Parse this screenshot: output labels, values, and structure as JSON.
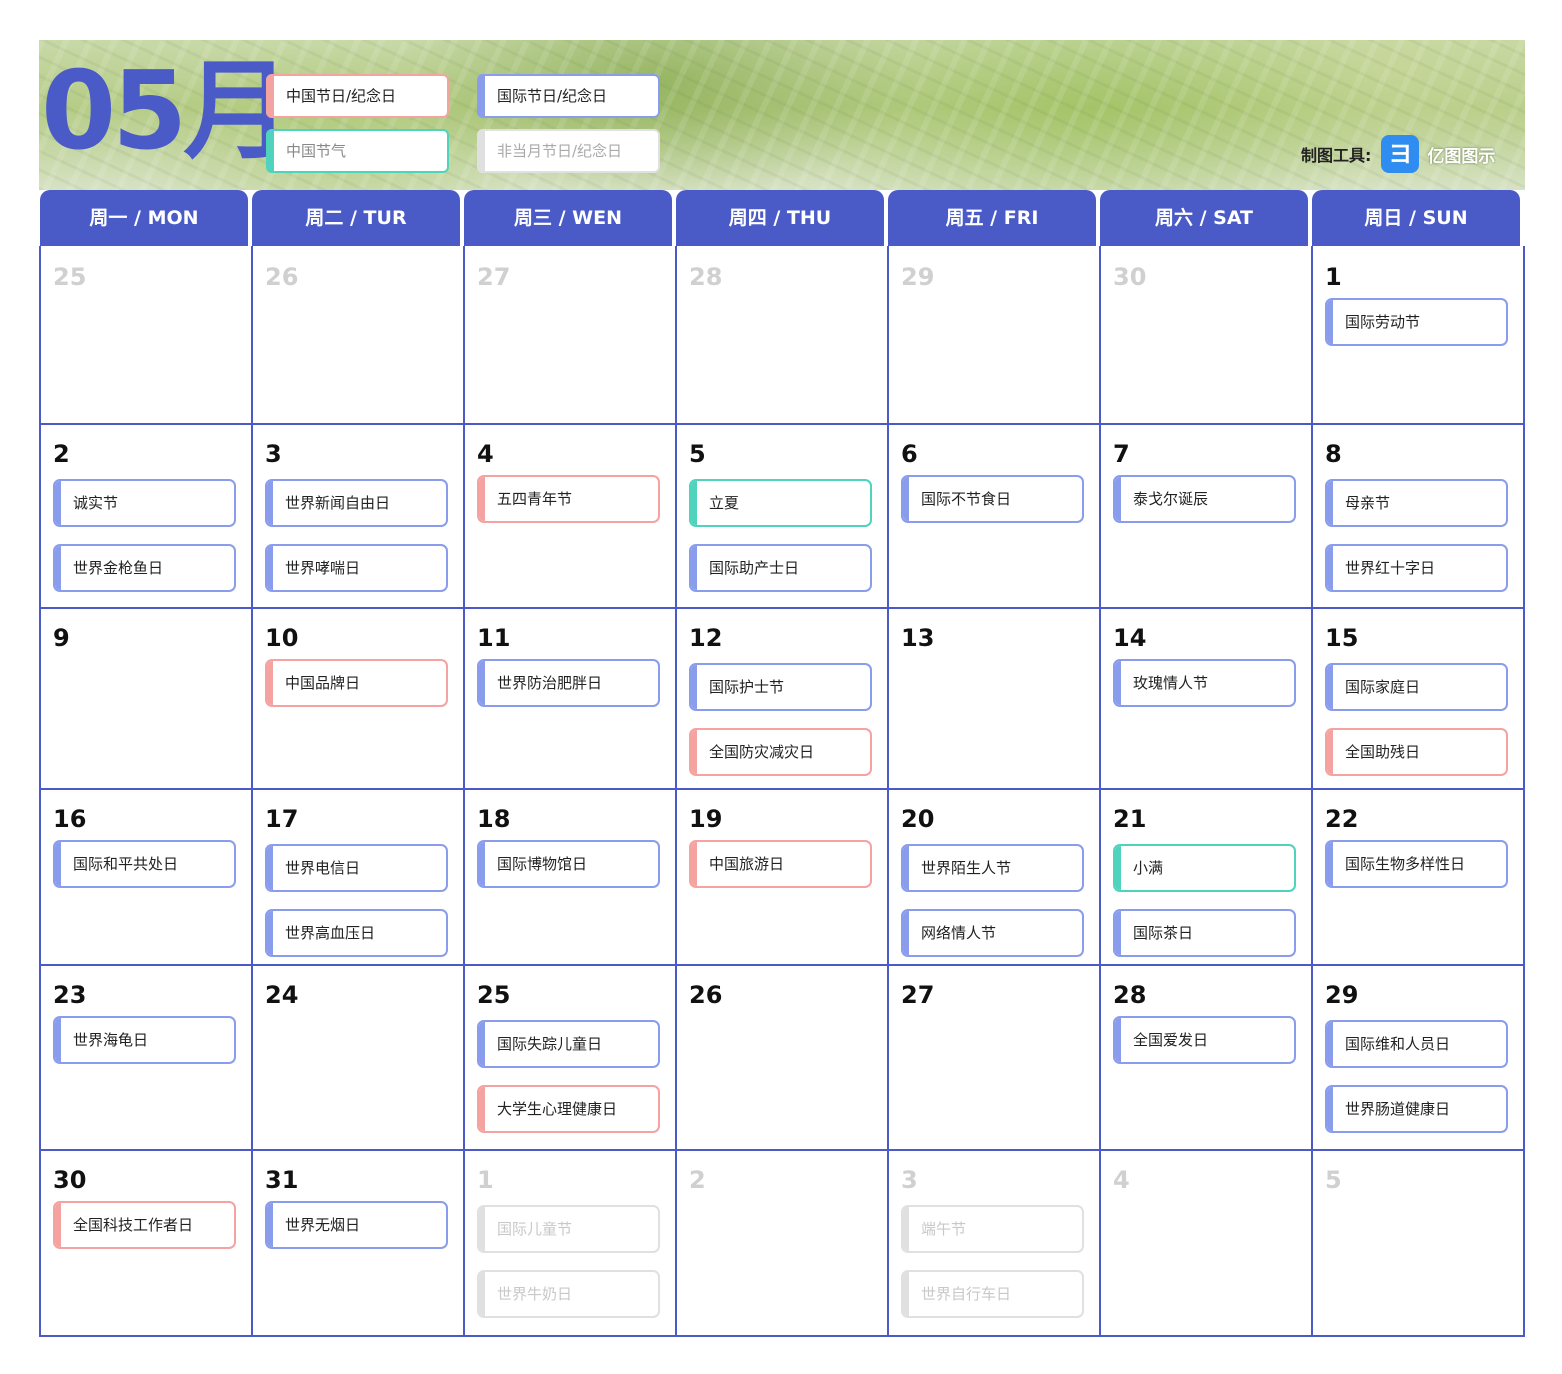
{
  "month_title": "05月",
  "legend": {
    "cn": "中国节日/纪念日",
    "intl": "国际节日/纪念日",
    "term": "中国节气",
    "other": "非当月节日/纪念日"
  },
  "tool": {
    "label": "制图工具:",
    "logo_glyph": "ヨ",
    "name": "亿图图示"
  },
  "colors": {
    "accent": "#4a5bc8",
    "cn": "#f4a3a1",
    "intl": "#8a9cec",
    "term": "#4fd3bd",
    "other": "#e0e0e0"
  },
  "weekdays": [
    "周一 / MON",
    "周二 / TUR",
    "周三 / WEN",
    "周四 / THU",
    "周五 / FRI",
    "周六 / SAT",
    "周日 / SUN"
  ],
  "weeks": [
    [
      {
        "day": "25",
        "other": true,
        "events": []
      },
      {
        "day": "26",
        "other": true,
        "events": []
      },
      {
        "day": "27",
        "other": true,
        "events": []
      },
      {
        "day": "28",
        "other": true,
        "events": []
      },
      {
        "day": "29",
        "other": true,
        "events": []
      },
      {
        "day": "30",
        "other": true,
        "events": []
      },
      {
        "day": "1",
        "events": [
          {
            "label": "国际劳动节",
            "type": "intl"
          }
        ]
      }
    ],
    [
      {
        "day": "2",
        "events": [
          {
            "label": "诚实节",
            "type": "intl"
          },
          {
            "label": "世界金枪鱼日",
            "type": "intl"
          }
        ]
      },
      {
        "day": "3",
        "events": [
          {
            "label": "世界新闻自由日",
            "type": "intl"
          },
          {
            "label": "世界哮喘日",
            "type": "intl"
          }
        ]
      },
      {
        "day": "4",
        "events": [
          {
            "label": "五四青年节",
            "type": "cn"
          }
        ]
      },
      {
        "day": "5",
        "events": [
          {
            "label": "立夏",
            "type": "term"
          },
          {
            "label": "国际助产士日",
            "type": "intl"
          }
        ]
      },
      {
        "day": "6",
        "events": [
          {
            "label": "国际不节食日",
            "type": "intl"
          }
        ]
      },
      {
        "day": "7",
        "events": [
          {
            "label": "泰戈尔诞辰",
            "type": "intl"
          }
        ]
      },
      {
        "day": "8",
        "events": [
          {
            "label": "母亲节",
            "type": "intl"
          },
          {
            "label": "世界红十字日",
            "type": "intl"
          }
        ]
      }
    ],
    [
      {
        "day": "9",
        "events": []
      },
      {
        "day": "10",
        "events": [
          {
            "label": "中国品牌日",
            "type": "cn"
          }
        ]
      },
      {
        "day": "11",
        "events": [
          {
            "label": "世界防治肥胖日",
            "type": "intl"
          }
        ]
      },
      {
        "day": "12",
        "events": [
          {
            "label": "国际护士节",
            "type": "intl"
          },
          {
            "label": "全国防灾减灾日",
            "type": "cn"
          }
        ]
      },
      {
        "day": "13",
        "events": []
      },
      {
        "day": "14",
        "events": [
          {
            "label": "玫瑰情人节",
            "type": "intl"
          }
        ]
      },
      {
        "day": "15",
        "events": [
          {
            "label": "国际家庭日",
            "type": "intl"
          },
          {
            "label": "全国助残日",
            "type": "cn"
          }
        ]
      }
    ],
    [
      {
        "day": "16",
        "events": [
          {
            "label": "国际和平共处日",
            "type": "intl"
          }
        ]
      },
      {
        "day": "17",
        "events": [
          {
            "label": "世界电信日",
            "type": "intl"
          },
          {
            "label": "世界高血压日",
            "type": "intl"
          }
        ]
      },
      {
        "day": "18",
        "events": [
          {
            "label": "国际博物馆日",
            "type": "intl"
          }
        ]
      },
      {
        "day": "19",
        "events": [
          {
            "label": "中国旅游日",
            "type": "cn"
          }
        ]
      },
      {
        "day": "20",
        "events": [
          {
            "label": "世界陌生人节",
            "type": "intl"
          },
          {
            "label": "网络情人节",
            "type": "intl"
          }
        ]
      },
      {
        "day": "21",
        "events": [
          {
            "label": "小满",
            "type": "term"
          },
          {
            "label": "国际茶日",
            "type": "intl"
          }
        ]
      },
      {
        "day": "22",
        "events": [
          {
            "label": "国际生物多样性日",
            "type": "intl"
          }
        ]
      }
    ],
    [
      {
        "day": "23",
        "events": [
          {
            "label": "世界海龟日",
            "type": "intl"
          }
        ]
      },
      {
        "day": "24",
        "events": []
      },
      {
        "day": "25",
        "events": [
          {
            "label": "国际失踪儿童日",
            "type": "intl"
          },
          {
            "label": "大学生心理健康日",
            "type": "cn"
          }
        ]
      },
      {
        "day": "26",
        "events": []
      },
      {
        "day": "27",
        "events": []
      },
      {
        "day": "28",
        "events": [
          {
            "label": "全国爱发日",
            "type": "intl"
          }
        ]
      },
      {
        "day": "29",
        "events": [
          {
            "label": "国际维和人员日",
            "type": "intl"
          },
          {
            "label": "世界肠道健康日",
            "type": "intl"
          }
        ]
      }
    ],
    [
      {
        "day": "30",
        "events": [
          {
            "label": "全国科技工作者日",
            "type": "cn"
          }
        ]
      },
      {
        "day": "31",
        "events": [
          {
            "label": "世界无烟日",
            "type": "intl"
          }
        ]
      },
      {
        "day": "1",
        "other": true,
        "events": [
          {
            "label": "国际儿童节",
            "type": "other"
          },
          {
            "label": "世界牛奶日",
            "type": "other"
          }
        ]
      },
      {
        "day": "2",
        "other": true,
        "events": []
      },
      {
        "day": "3",
        "other": true,
        "events": [
          {
            "label": "端午节",
            "type": "other"
          },
          {
            "label": "世界自行车日",
            "type": "other"
          }
        ]
      },
      {
        "day": "4",
        "other": true,
        "events": []
      },
      {
        "day": "5",
        "other": true,
        "events": []
      }
    ]
  ]
}
